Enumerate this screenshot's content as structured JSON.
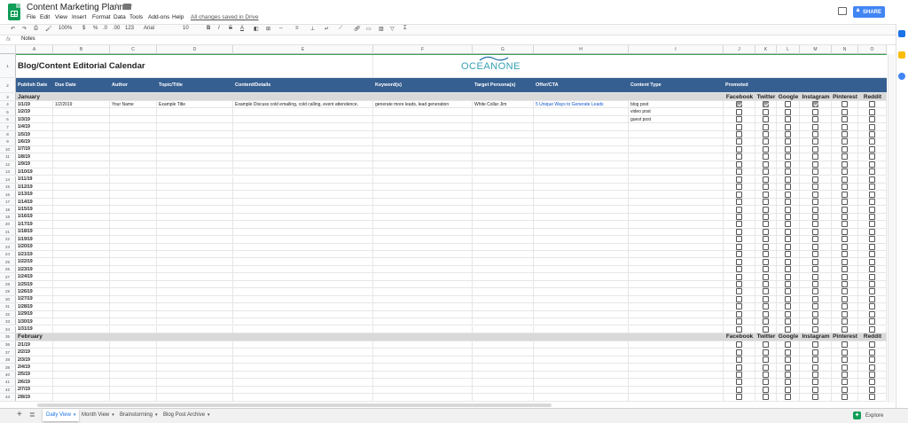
{
  "app": {
    "title": "Content Marketing Planner",
    "star_icon": "star-icon",
    "folder_icon": "folder-icon",
    "menu": [
      "File",
      "Edit",
      "View",
      "Insert",
      "Format",
      "Data",
      "Tools",
      "Add-ons",
      "Help"
    ],
    "saved_status": "All changes saved in Drive",
    "share_label": "SHARE"
  },
  "toolbar": {
    "zoom": "100%",
    "currency": "$",
    "percent": "%",
    "dec_less": ".0",
    "dec_more": ".00",
    "format_more": "123",
    "font": "Arial",
    "font_size": "10",
    "bold": "B",
    "italic": "I",
    "strike": "S",
    "text_color": "A",
    "sum": "Σ"
  },
  "formula_bar": {
    "fx": "fx",
    "value": "Notes"
  },
  "columns": [
    "A",
    "B",
    "C",
    "D",
    "E",
    "F",
    "G",
    "H",
    "I",
    "J",
    "K",
    "L",
    "M",
    "N",
    "O"
  ],
  "sheet": {
    "title": "Blog/Content Editorial Calendar",
    "logo_text": "OCEANONE",
    "headers": [
      "Publish Date",
      "Due Date",
      "Author",
      "Topic/Title",
      "Content/Details",
      "Keyword(s)",
      "Target Persona(s)",
      "Offer/CTA",
      "Content Type",
      "Promoted"
    ],
    "platforms": [
      "Facebook",
      "Twitter",
      "Google",
      "Instagram",
      "Pinterest",
      "Reddit"
    ],
    "january": {
      "label": "January",
      "example": {
        "date": "1/1/19",
        "due": "1/2/2019",
        "author": "Your Name",
        "topic": "Example Title",
        "details": "Example Discuss cold emailing, cold calling, event attendence,",
        "keywords": "generate more leads, lead generation",
        "persona": "White Collar Jim",
        "offer": "5 Unique Ways to Generate Leads",
        "content_type": "blog post",
        "checked": [
          true,
          true,
          false,
          true,
          false,
          false
        ]
      },
      "extra_types": [
        "video post",
        "guest post"
      ],
      "dates": [
        "1/2/19",
        "1/3/19",
        "1/4/19",
        "1/5/19",
        "1/6/19",
        "1/7/19",
        "1/8/19",
        "1/9/19",
        "1/10/19",
        "1/11/19",
        "1/12/19",
        "1/13/19",
        "1/14/19",
        "1/15/19",
        "1/16/19",
        "1/17/19",
        "1/18/19",
        "1/19/19",
        "1/20/19",
        "1/21/19",
        "1/22/19",
        "1/23/19",
        "1/24/19",
        "1/25/19",
        "1/26/19",
        "1/27/19",
        "1/28/19",
        "1/29/19",
        "1/30/19",
        "1/31/19"
      ]
    },
    "february": {
      "label": "February",
      "dates": [
        "2/1/19",
        "2/2/19",
        "2/3/19",
        "2/4/19",
        "2/5/19",
        "2/6/19",
        "2/7/19",
        "2/8/19"
      ]
    },
    "row_numbers_start": 1
  },
  "tabs": [
    {
      "label": "Daily View",
      "active": true
    },
    {
      "label": "Month View",
      "active": false
    },
    {
      "label": "Brainstorming",
      "active": false
    },
    {
      "label": "Blog Post Archive",
      "active": false
    }
  ],
  "explore_label": "Explore",
  "colors": {
    "header_blue": "#365f91",
    "month_gray": "#d9d9d9",
    "sheets_green": "#0f9d58",
    "share_blue": "#4285f4",
    "logo_teal": "#35a1b5"
  }
}
